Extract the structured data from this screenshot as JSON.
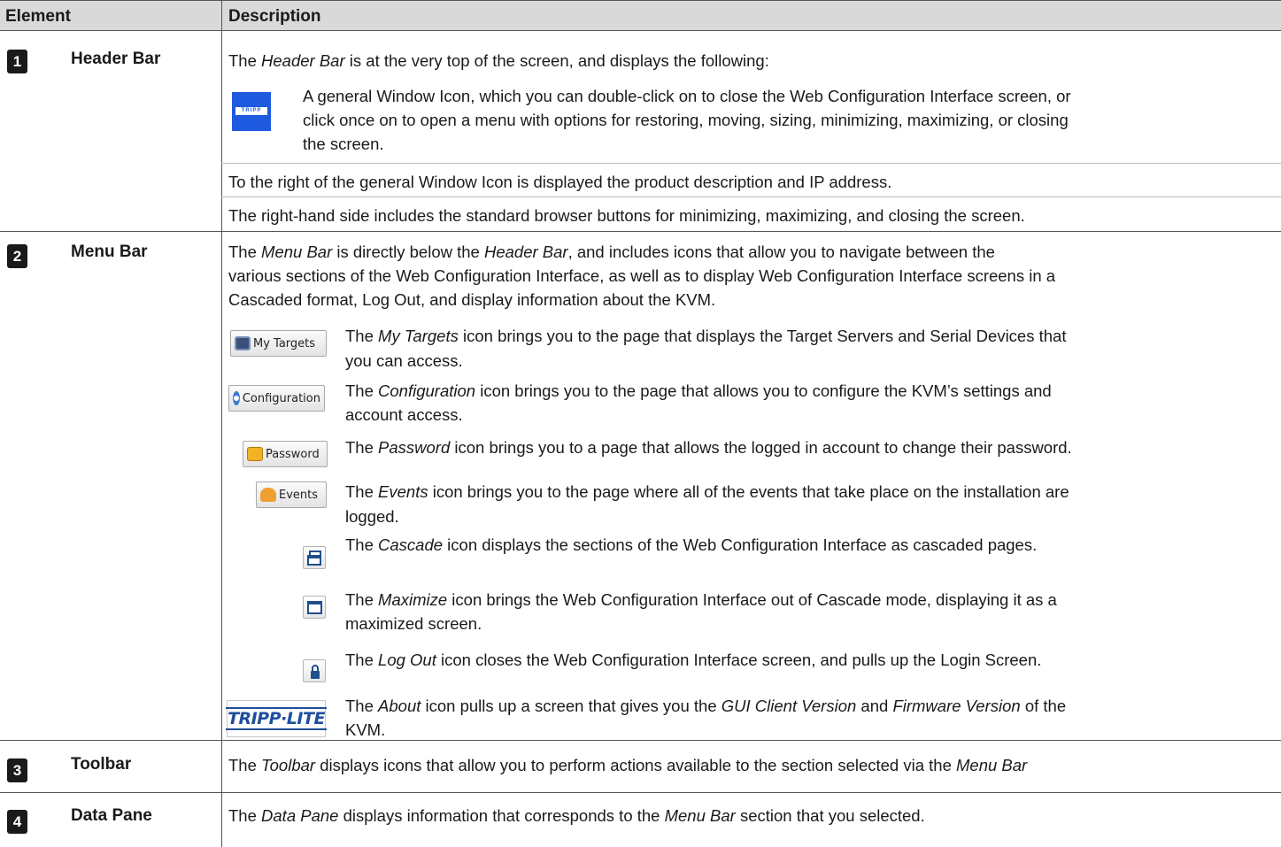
{
  "header": {
    "element": "Element",
    "description": "Description"
  },
  "rows": [
    {
      "num": "1",
      "name": "Header Bar"
    },
    {
      "num": "2",
      "name": "Menu Bar"
    },
    {
      "num": "3",
      "name": "Toolbar"
    },
    {
      "num": "4",
      "name": "Data Pane"
    }
  ],
  "header_bar": {
    "intro_prefix": "The ",
    "intro_em": "Header Bar",
    "intro_suffix": " is at the very top of the screen, and displays the following:",
    "window_icon_text_1": "A general Window Icon, which you can double-click on to close the Web Configuration Interface screen, or",
    "window_icon_text_2": "click once on to open a menu with options for  restoring, moving, sizing, minimizing, maximizing, or closing",
    "window_icon_text_3": "the screen.",
    "window_icon_label": "TRIPP",
    "product_desc": "To the right of the general Window Icon is displayed the product description and IP address.",
    "right_side": "The right-hand side includes the standard browser buttons for minimizing, maximizing, and closing the screen."
  },
  "menu_bar": {
    "intro_1_prefix": "The ",
    "intro_1_em": "Menu Bar",
    "intro_1_mid": " is directly below the ",
    "intro_1_em2": "Header Bar",
    "intro_1_suffix": ", and includes icons that allow you to navigate between the",
    "intro_2": "various sections of the Web Configuration Interface, as well as to display Web Configuration Interface screens in a",
    "intro_3": "Cascaded format, Log Out, and display information about the KVM.",
    "items": [
      {
        "icon_label": "My Targets",
        "icon": "monitor-icon",
        "em": "My Targets",
        "line1": " icon brings you to the page that displays the Target Servers and Serial Devices that",
        "line2": "you can access."
      },
      {
        "icon_label": "Configuration",
        "icon": "gear-icon",
        "em": "Configuration",
        "line1": " icon brings you to the page that allows you to configure the KVM’s settings and",
        "line2": "account access."
      },
      {
        "icon_label": "Password",
        "icon": "lock-icon",
        "em": "Password",
        "line1": " icon brings you to a page that allows the logged in account to change their password.",
        "line2": ""
      },
      {
        "icon_label": "Events",
        "icon": "bell-icon",
        "em": "Events",
        "line1": " icon brings you to the page where all of the events that take place on the installation are",
        "line2": "logged."
      },
      {
        "icon_label": "",
        "icon": "cascade-icon",
        "em": "Cascade",
        "line1": " icon displays the sections of the Web Configuration Interface as cascaded pages.",
        "line2": ""
      },
      {
        "icon_label": "",
        "icon": "maximize-icon",
        "em": "Maximize",
        "line1": " icon brings the Web Configuration Interface out of Cascade mode, displaying it as a",
        "line2": "maximized screen."
      },
      {
        "icon_label": "",
        "icon": "padlock-icon",
        "em": "Log Out",
        "line1": " icon closes the Web Configuration Interface screen, and pulls up the Login Screen.",
        "line2": ""
      },
      {
        "icon_label": "TRIPP·LITE",
        "icon": "tripp-lite-logo",
        "em": "About",
        "line1a": " icon pulls up a screen that gives you the ",
        "em2": "GUI Client Version",
        "line1b": " and ",
        "em3": "Firmware Version",
        "line1c": " of the",
        "line2": "KVM."
      }
    ],
    "the": "The "
  },
  "toolbar": {
    "prefix": "The ",
    "em": "Toolbar",
    "mid": " displays icons that allow you to perform actions available to the section selected via the ",
    "em2": "Menu Bar"
  },
  "data_pane": {
    "prefix": "The ",
    "em": "Data Pane",
    "mid": " displays information that corresponds to the ",
    "em2": "Menu Bar",
    "suffix": " section that you selected."
  }
}
